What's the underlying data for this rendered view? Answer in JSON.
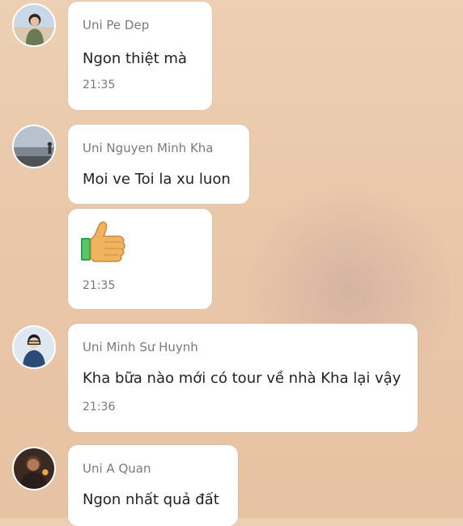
{
  "messages": [
    {
      "sender": "Uni Pe Dep",
      "text": "Ngon thiệt mà",
      "time": "21:35",
      "avatar": "avatar-pe-dep"
    },
    {
      "sender": "Uni Nguyen Minh Kha",
      "text": "Moi ve Toi la xu luon",
      "avatar": "avatar-nguyen-minh-kha"
    },
    {
      "sticker": "thumbs-up-icon",
      "time": "21:35"
    },
    {
      "sender": "Uni Minh Sư Huynh",
      "text": "Kha bữa nào mới có tour về nhà Kha lại vậy",
      "time": "21:36",
      "avatar": "avatar-minh-su-huynh"
    },
    {
      "sender": "Uni A Quan",
      "text": "Ngon nhất quả đất",
      "avatar": "avatar-a-quan"
    }
  ]
}
